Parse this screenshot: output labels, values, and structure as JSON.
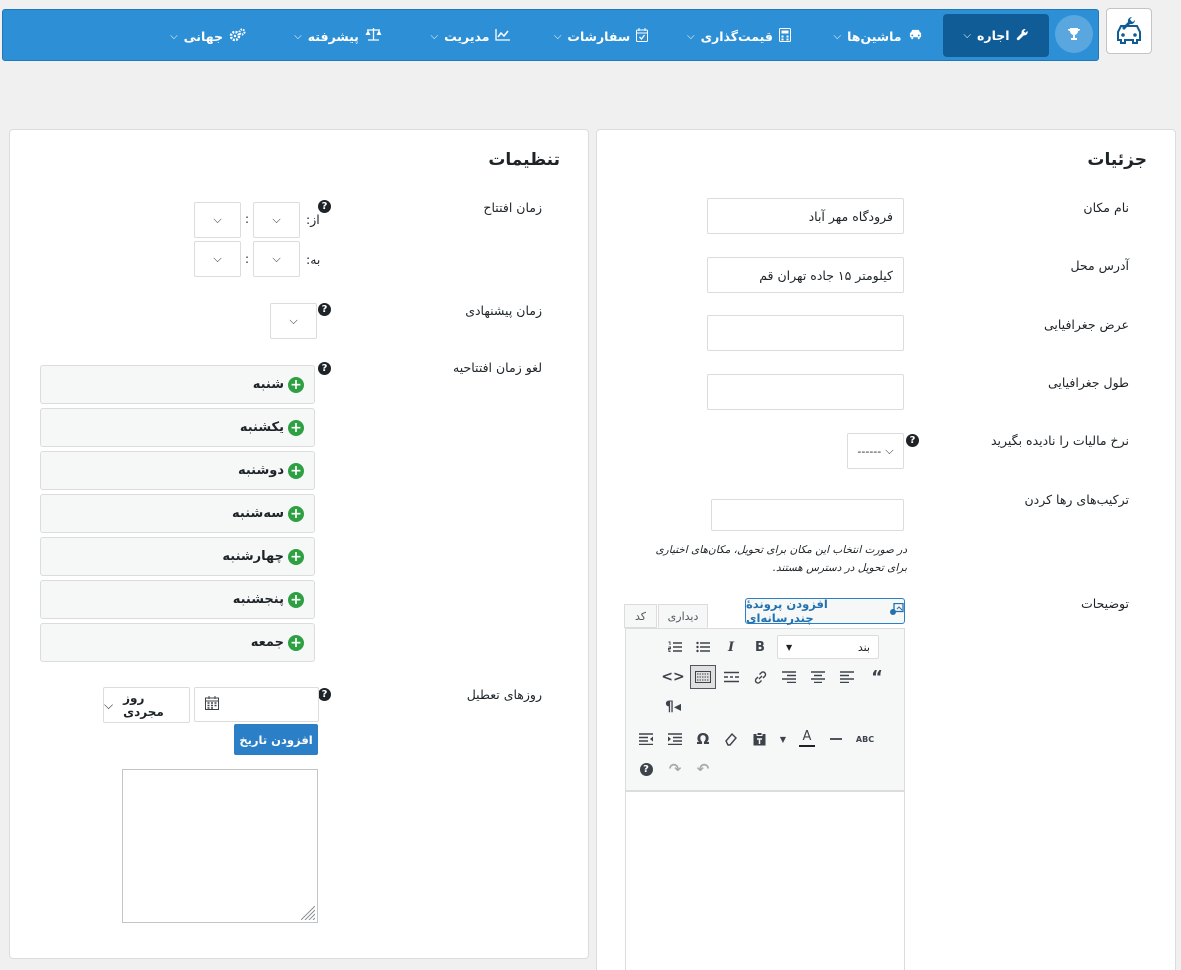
{
  "nav": {
    "items": [
      {
        "label": "اجاره",
        "icon": "wrench-icon",
        "active": true
      },
      {
        "label": "ماشین‌ها",
        "icon": "car-icon"
      },
      {
        "label": "قیمت‌گذاری",
        "icon": "calculator-icon"
      },
      {
        "label": "سفارشات",
        "icon": "calendar-check-icon"
      },
      {
        "label": "مدیریت",
        "icon": "chart-line-icon"
      },
      {
        "label": "پیشرفته",
        "icon": "balance-scale-icon"
      },
      {
        "label": "جهانی",
        "icon": "cogs-icon"
      }
    ]
  },
  "details": {
    "title": "جزئیات",
    "location_name_label": "نام مکان",
    "location_name_value": "فرودگاه مهر آباد",
    "address_label": "آدرس محل",
    "address_value": "کیلومتر ۱۵ جاده تهران قم",
    "latitude_label": "عرض جغرافیایی",
    "longitude_label": "طول جغرافیایی",
    "tax_label": "نرخ مالیات را نادیده بگیرید",
    "tax_value": "------",
    "dropoff_label": "ترکیب‌های رها کردن",
    "dropoff_note": "در صورت انتخاب این مکان برای تحویل، مکان‌های اختیاری برای تحویل در دسترس هستند.",
    "description_label": "توضیحات",
    "add_media_label": "افزودن پروندهٔ چندرسانه‌ای",
    "tab_visual": "دیداری",
    "tab_code": "کد",
    "paragraph_select": "بند"
  },
  "settings": {
    "title": "تنظیمات",
    "opening_time_label": "زمان افتتاح",
    "from_label": "از:",
    "to_label": "به:",
    "suggested_time_label": "زمان پیشنهادی",
    "cancel_opening_label": "لغو زمان افتتاحیه",
    "days": [
      "شنبه",
      "یکشنبه",
      "دوشنبه",
      "سه‌شنبه",
      "چهارشنبه",
      "پنجشنبه",
      "جمعه"
    ],
    "holidays_label": "روزهای تعطیل",
    "single_day": "روز مجردی",
    "add_date_button": "افزودن تاریخ"
  },
  "colors": {
    "nav_bg": "#2d8fd5",
    "nav_active": "#0f5c96",
    "plus_green": "#2ea043",
    "primary_button": "#2b7fc7"
  }
}
